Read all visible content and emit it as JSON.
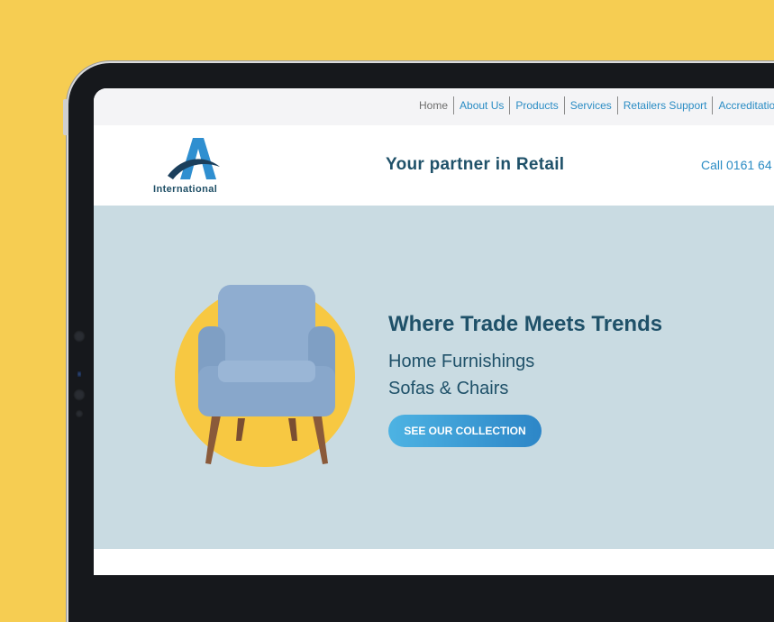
{
  "nav": {
    "items": [
      "Home",
      "About Us",
      "Products",
      "Services",
      "Retailers Support",
      "Accreditations"
    ]
  },
  "header": {
    "logo_text": "International",
    "tagline": "Your partner in Retail",
    "call_text": "Call 0161 64"
  },
  "hero": {
    "title": "Where Trade Meets Trends",
    "line1": "Home Furnishings",
    "line2": "Sofas & Chairs",
    "cta_label": "SEE OUR COLLECTION"
  },
  "colors": {
    "background": "#f6cd52",
    "brand_dark": "#1f5169",
    "link_blue": "#2a8cc4",
    "hero_bg": "#c9dbe2",
    "circle": "#f7c842"
  },
  "icons": {
    "logo": "letter-a-swoosh-logo",
    "product": "armchair-image"
  }
}
